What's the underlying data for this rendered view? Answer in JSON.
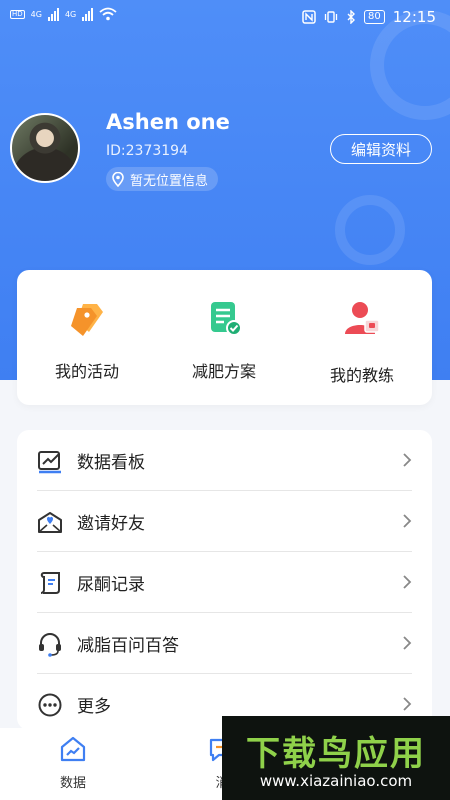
{
  "status_bar": {
    "network_1": "4G",
    "network_2": "4G",
    "battery": "80",
    "time": "12:15"
  },
  "profile": {
    "username": "Ashen one",
    "user_id": "ID:2373194",
    "location": "暂无位置信息",
    "edit_label": "编辑资料"
  },
  "quick_actions": [
    {
      "label": "我的活动",
      "icon": "tags-icon"
    },
    {
      "label": "减肥方案",
      "icon": "plan-document-icon"
    },
    {
      "label": "我的教练",
      "icon": "coach-user-icon"
    }
  ],
  "menu": [
    {
      "label": "数据看板",
      "icon": "chart-board-icon"
    },
    {
      "label": "邀请好友",
      "icon": "invite-envelope-icon"
    },
    {
      "label": "尿酮记录",
      "icon": "record-scroll-icon"
    },
    {
      "label": "减脂百问百答",
      "icon": "headset-icon"
    },
    {
      "label": "更多",
      "icon": "more-dots-icon"
    }
  ],
  "tabs": [
    {
      "label": "数据",
      "icon": "home-chart-icon"
    },
    {
      "label": "消",
      "icon": "message-icon"
    }
  ],
  "watermark": {
    "title": "下载鸟应用",
    "url": "www.xiazainiao.com"
  },
  "colors": {
    "accent": "#3f7ff2",
    "orange": "#f5932a",
    "green": "#35c98f",
    "red": "#ec4b55"
  }
}
